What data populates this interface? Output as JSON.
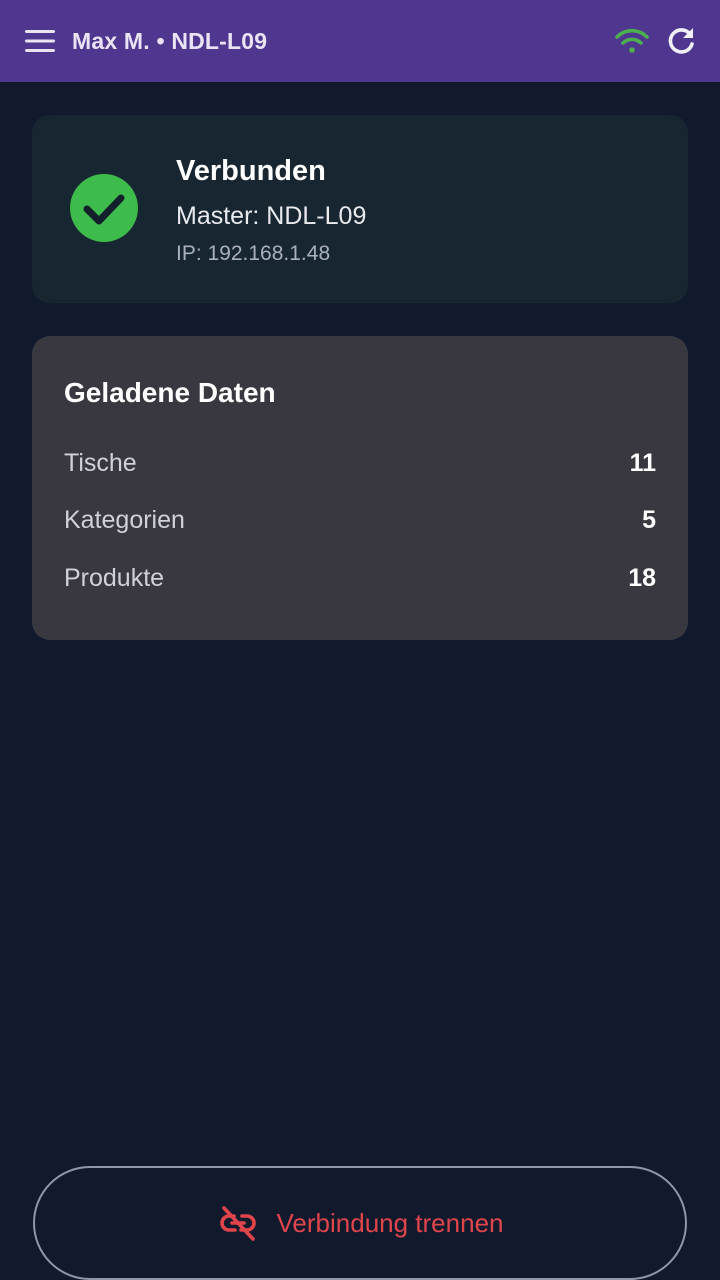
{
  "header": {
    "title": "Max M. • NDL-L09",
    "menu_icon": "menu-icon",
    "wifi_icon": "wifi-icon",
    "refresh_icon": "refresh-icon",
    "bar_color": "#4f368f",
    "wifi_color": "#4caf50"
  },
  "status": {
    "title": "Verbunden",
    "master": "Master: NDL-L09",
    "ip": "IP: 192.168.1.48",
    "icon": "check-circle-icon",
    "accent": "#3dbb4c"
  },
  "loaded_data": {
    "title": "Geladene Daten",
    "rows": [
      {
        "label": "Tische",
        "value": "11"
      },
      {
        "label": "Kategorien",
        "value": "5"
      },
      {
        "label": "Produkte",
        "value": "18"
      }
    ]
  },
  "actions": {
    "disconnect_label": "Verbindung trennen",
    "disconnect_icon": "unlink-icon",
    "danger_color": "#e0454c"
  }
}
